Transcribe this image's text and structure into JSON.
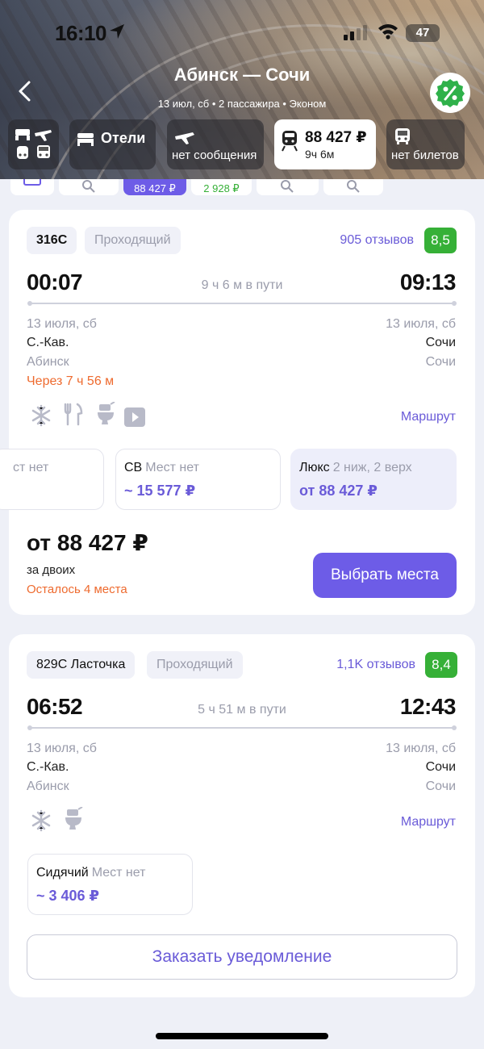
{
  "status_bar": {
    "time": "16:10",
    "battery": "47"
  },
  "header": {
    "title": "Абинск — Сочи",
    "subtitle": "13 июл, сб  •  2 пассажира  •  Эконом"
  },
  "transport_tabs": [
    {
      "id": "all",
      "label": ""
    },
    {
      "id": "hotels",
      "label": "Отели"
    },
    {
      "id": "plane",
      "label": "нет сообщения"
    },
    {
      "id": "train",
      "label": "88 427 ₽",
      "sublabel": "9ч 6м"
    },
    {
      "id": "bus",
      "label": "нет билетов"
    }
  ],
  "filter_chips": {
    "price_a": "88 427 ₽",
    "price_b": "2 928 ₽"
  },
  "trains": [
    {
      "number": "316С",
      "tag": "Проходящий",
      "reviews": "905 отзывов",
      "rating": "8,5",
      "depart_time": "00:07",
      "duration": "9 ч 6 м в пути",
      "arrive_time": "09:13",
      "depart_date": "13 июля, сб",
      "arrive_date": "13 июля, сб",
      "depart_station": "С.-Кав.",
      "depart_city": "Абинск",
      "arrive_station": "Сочи",
      "arrive_city": "Сочи",
      "departs_in": "Через 7 ч 56 м",
      "route_link": "Маршрут",
      "seats": [
        {
          "cls": "",
          "note": "ст нет",
          "price": ""
        },
        {
          "cls": "СВ",
          "note": "Мест нет",
          "price": "~ 15 577 ₽"
        },
        {
          "cls": "Люкс",
          "note": "2 ниж, 2 верх",
          "price": "от 88 427 ₽"
        }
      ],
      "total_price": "от 88 427 ₽",
      "total_for": "за двоих",
      "left_seats": "Осталось 4 места",
      "cta": "Выбрать места"
    },
    {
      "number": "829С Ласточка",
      "tag": "Проходящий",
      "reviews": "1,1K отзывов",
      "rating": "8,4",
      "depart_time": "06:52",
      "duration": "5 ч 51 м в пути",
      "arrive_time": "12:43",
      "depart_date": "13 июля, сб",
      "arrive_date": "13 июля, сб",
      "depart_station": "С.-Кав.",
      "depart_city": "Абинск",
      "arrive_station": "Сочи",
      "arrive_city": "Сочи",
      "route_link": "Маршрут",
      "seats": [
        {
          "cls": "Сидячий",
          "note": "Мест нет",
          "price": "~ 3 406 ₽"
        }
      ],
      "cta": "Заказать уведомление"
    }
  ],
  "colors": {
    "accent": "#6d5ce7",
    "rating": "#36b037",
    "warning": "#ee6a2e"
  }
}
